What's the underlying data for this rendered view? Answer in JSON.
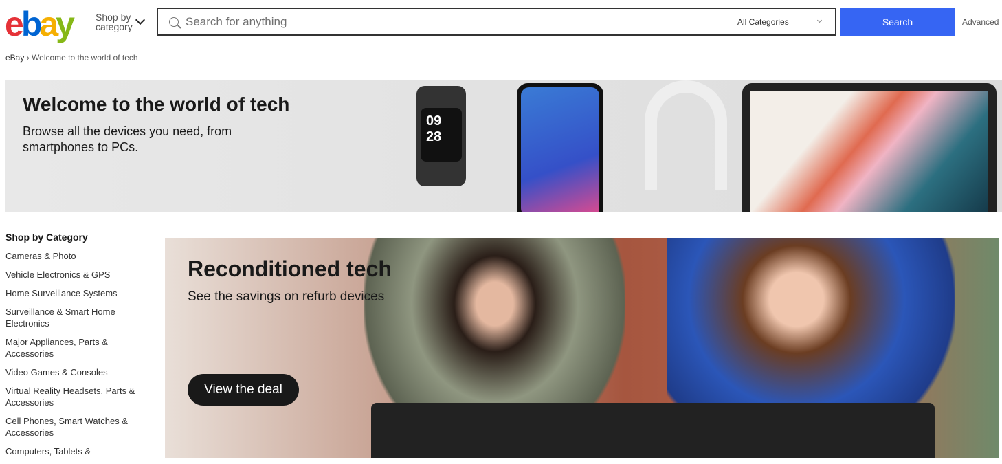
{
  "header": {
    "logo": "ebay",
    "shop_by": "Shop by",
    "shop_by2": "category",
    "search_placeholder": "Search for anything",
    "category_select": "All Categories",
    "search_button": "Search",
    "advanced": "Advanced",
    "colors": {
      "e": "#e53238",
      "b": "#0064d2",
      "a": "#f5af02",
      "y": "#86b817",
      "search": "#3665f3"
    }
  },
  "breadcrumb": {
    "home": "eBay",
    "sep": "›",
    "current": "Welcome to the world of tech"
  },
  "hero": {
    "title": "Welcome to the world of tech",
    "subtitle": "Browse all the devices you need, from smartphones to PCs.",
    "watch_time1": "09",
    "watch_time2": "28"
  },
  "sidebar": {
    "title": "Shop by Category",
    "items": [
      "Cameras & Photo",
      "Vehicle Electronics & GPS",
      "Home Surveillance Systems",
      "Surveillance & Smart Home Electronics",
      "Major Appliances, Parts & Accessories",
      "Video Games & Consoles",
      "Virtual Reality Headsets, Parts & Accessories",
      "Cell Phones, Smart Watches & Accessories",
      "Computers, Tablets &"
    ]
  },
  "promo": {
    "title": "Reconditioned tech",
    "subtitle": "See the savings on refurb devices",
    "button": "View the deal"
  }
}
